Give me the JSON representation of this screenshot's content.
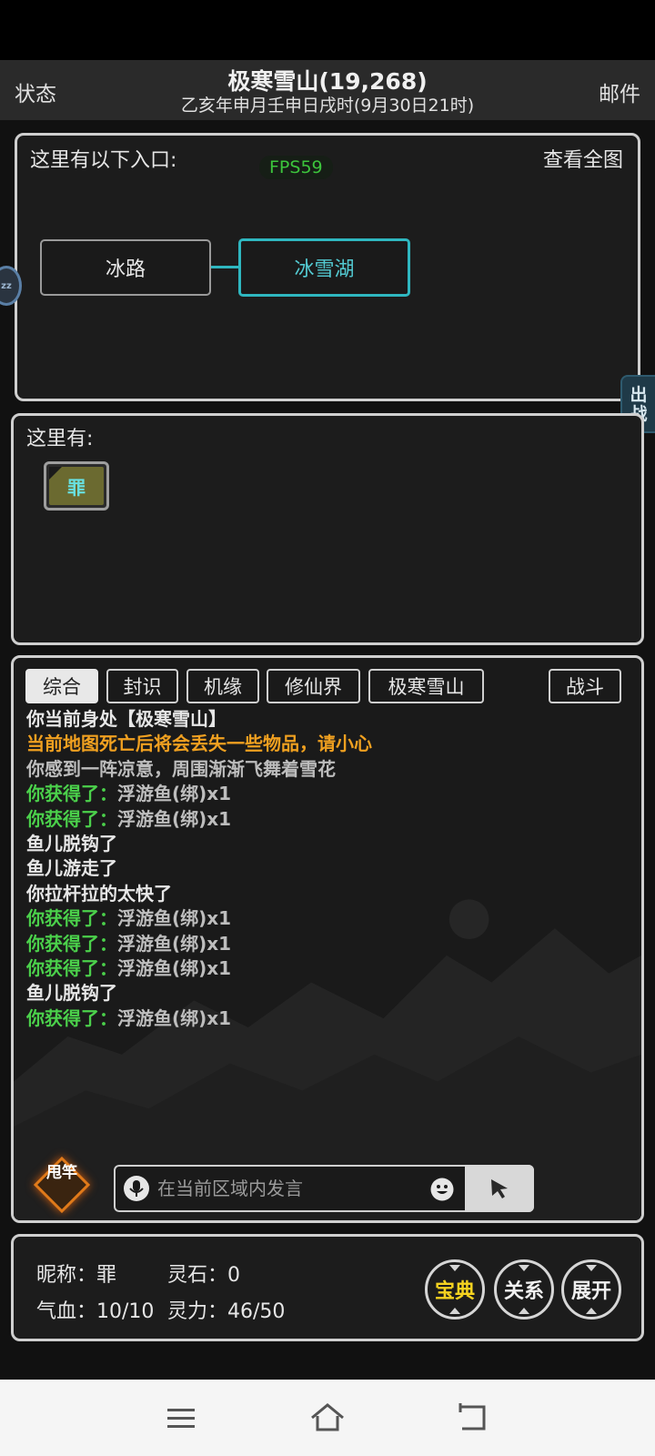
{
  "header": {
    "left_label": "状态",
    "title": "极寒雪山(19,268)",
    "subtitle": "乙亥年申月壬申日戌时(9月30日21时)",
    "right_label": "邮件"
  },
  "map": {
    "entrance_label": "这里有以下入口:",
    "fps": "FPS59",
    "view_full_map": "查看全图",
    "rooms": [
      "冰路",
      "冰雪湖"
    ],
    "current_room_color": "#2fb7c0"
  },
  "side": {
    "sleep_badge": "zz",
    "battle_tab": "出战"
  },
  "presence": {
    "label": "这里有:",
    "player_token": "罪"
  },
  "chat": {
    "tabs": [
      "综合",
      "封识",
      "机缘",
      "修仙界",
      "极寒雪山"
    ],
    "active_tab": "综合",
    "battle_tab": "战斗",
    "log": [
      {
        "prefix": "",
        "text": "你当前身处【极寒雪山】",
        "color": "white"
      },
      {
        "prefix": "",
        "text": "当前地图死亡后将会丢失一些物品，请小心",
        "color": "orange"
      },
      {
        "prefix": "",
        "text": "你感到一阵凉意，周围渐渐飞舞着雪花",
        "color": "gray"
      },
      {
        "prefix": "你获得了：",
        "text": "浮游鱼(绑)x1",
        "color": "gain"
      },
      {
        "prefix": "你获得了：",
        "text": "浮游鱼(绑)x1",
        "color": "gain"
      },
      {
        "prefix": "",
        "text": "鱼儿脱钩了",
        "color": "white"
      },
      {
        "prefix": "",
        "text": "鱼儿游走了",
        "color": "white"
      },
      {
        "prefix": "",
        "text": "你拉杆拉的太快了",
        "color": "white"
      },
      {
        "prefix": "你获得了：",
        "text": "浮游鱼(绑)x1",
        "color": "gain"
      },
      {
        "prefix": "你获得了：",
        "text": "浮游鱼(绑)x1",
        "color": "gain"
      },
      {
        "prefix": "你获得了：",
        "text": "浮游鱼(绑)x1",
        "color": "gain"
      },
      {
        "prefix": "",
        "text": "鱼儿脱钩了",
        "color": "white"
      },
      {
        "prefix": "你获得了：",
        "text": "浮游鱼(绑)x1",
        "color": "gain"
      }
    ],
    "fishing_button": "甩竿",
    "input_placeholder": "在当前区域内发言"
  },
  "stats": {
    "nickname_label": "昵称：",
    "nickname": "罪",
    "spirit_stone_label": "灵石：",
    "spirit_stone": "0",
    "hp_label": "气血：",
    "hp": "10/10",
    "mana_label": "灵力：",
    "mana": "46/50",
    "buttons": [
      "宝典",
      "关系",
      "展开"
    ]
  },
  "icons": {
    "sleep": "sleep-icon",
    "mic": "microphone-icon",
    "emoji": "emoji-icon",
    "send": "send-cursor-icon",
    "nav": [
      "menu-icon",
      "home-icon",
      "back-icon"
    ]
  },
  "colors": {
    "accent_teal": "#2fb7c0",
    "warning_orange": "#f0a020",
    "gain_green": "#4bd14b",
    "fps_green": "#3cc43c",
    "gold": "#f5d320"
  }
}
